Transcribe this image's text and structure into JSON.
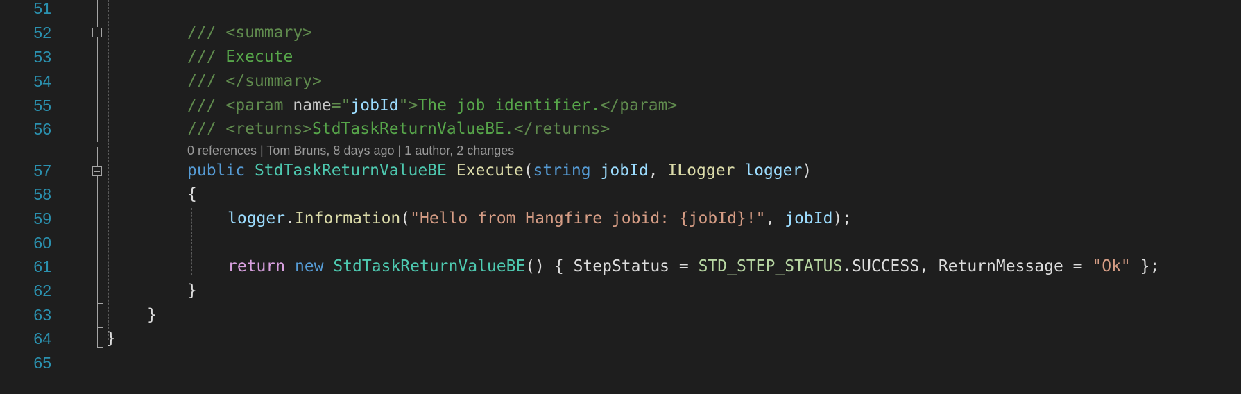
{
  "editor": {
    "lines": [
      {
        "num": "51",
        "tokens": []
      },
      {
        "num": "52",
        "tokens": [
          {
            "text": "/// ",
            "cls": "t-comtag"
          },
          {
            "text": "<summary>",
            "cls": "t-comtag"
          }
        ]
      },
      {
        "num": "53",
        "tokens": [
          {
            "text": "/// ",
            "cls": "t-comtag"
          },
          {
            "text": "Execute",
            "cls": "t-com"
          }
        ]
      },
      {
        "num": "54",
        "tokens": [
          {
            "text": "/// ",
            "cls": "t-comtag"
          },
          {
            "text": "</summary>",
            "cls": "t-comtag"
          }
        ]
      },
      {
        "num": "55",
        "tokens": [
          {
            "text": "/// ",
            "cls": "t-comtag"
          },
          {
            "text": "<param ",
            "cls": "t-comtag"
          },
          {
            "text": "name",
            "cls": "t-attr"
          },
          {
            "text": "=\"",
            "cls": "t-comtag"
          },
          {
            "text": "jobId",
            "cls": "t-param"
          },
          {
            "text": "\"",
            "cls": "t-comtag"
          },
          {
            "text": ">",
            "cls": "t-comtag"
          },
          {
            "text": "The job identifier.",
            "cls": "t-com"
          },
          {
            "text": "</param>",
            "cls": "t-comtag"
          }
        ]
      },
      {
        "num": "56",
        "tokens": [
          {
            "text": "/// ",
            "cls": "t-comtag"
          },
          {
            "text": "<returns>",
            "cls": "t-comtag"
          },
          {
            "text": "StdTaskReturnValueBE.",
            "cls": "t-com"
          },
          {
            "text": "</returns>",
            "cls": "t-comtag"
          }
        ]
      },
      {
        "num": "57",
        "tokens": [
          {
            "text": "public ",
            "cls": "t-kw"
          },
          {
            "text": "StdTaskReturnValueBE",
            "cls": "t-type"
          },
          {
            "text": " ",
            "cls": "t-plain"
          },
          {
            "text": "Execute",
            "cls": "t-method"
          },
          {
            "text": "(",
            "cls": "t-plain"
          },
          {
            "text": "string",
            "cls": "t-kw"
          },
          {
            "text": " ",
            "cls": "t-plain"
          },
          {
            "text": "jobId",
            "cls": "t-param"
          },
          {
            "text": ", ",
            "cls": "t-plain"
          },
          {
            "text": "ILogger",
            "cls": "t-method"
          },
          {
            "text": " ",
            "cls": "t-plain"
          },
          {
            "text": "logger",
            "cls": "t-param"
          },
          {
            "text": ")",
            "cls": "t-plain"
          }
        ]
      },
      {
        "num": "58",
        "tokens": [
          {
            "text": "{",
            "cls": "t-plain"
          }
        ]
      },
      {
        "num": "59",
        "tokens": [
          {
            "text": "logger",
            "cls": "t-param"
          },
          {
            "text": ".",
            "cls": "t-plain"
          },
          {
            "text": "Information",
            "cls": "t-method"
          },
          {
            "text": "(",
            "cls": "t-plain"
          },
          {
            "text": "\"Hello from Hangfire jobid: {jobId}!\"",
            "cls": "t-str"
          },
          {
            "text": ", ",
            "cls": "t-plain"
          },
          {
            "text": "jobId",
            "cls": "t-param"
          },
          {
            "text": ");",
            "cls": "t-plain"
          }
        ]
      },
      {
        "num": "60",
        "tokens": []
      },
      {
        "num": "61",
        "tokens": [
          {
            "text": "return",
            "cls": "t-ctrl"
          },
          {
            "text": " ",
            "cls": "t-plain"
          },
          {
            "text": "new",
            "cls": "t-kw"
          },
          {
            "text": " ",
            "cls": "t-plain"
          },
          {
            "text": "StdTaskReturnValueBE",
            "cls": "t-type"
          },
          {
            "text": "() { ",
            "cls": "t-plain"
          },
          {
            "text": "StepStatus",
            "cls": "t-plain"
          },
          {
            "text": " = ",
            "cls": "t-plain"
          },
          {
            "text": "STD_STEP_STATUS",
            "cls": "t-enum"
          },
          {
            "text": ".",
            "cls": "t-plain"
          },
          {
            "text": "SUCCESS",
            "cls": "t-plain"
          },
          {
            "text": ", ",
            "cls": "t-plain"
          },
          {
            "text": "ReturnMessage",
            "cls": "t-plain"
          },
          {
            "text": " = ",
            "cls": "t-plain"
          },
          {
            "text": "\"Ok\"",
            "cls": "t-str"
          },
          {
            "text": " };",
            "cls": "t-plain"
          }
        ]
      },
      {
        "num": "62",
        "tokens": [
          {
            "text": "}",
            "cls": "t-plain"
          }
        ]
      },
      {
        "num": "63",
        "tokens": [
          {
            "text": "}",
            "cls": "t-plain"
          }
        ]
      },
      {
        "num": "64",
        "tokens": [
          {
            "text": "}",
            "cls": "t-plain"
          }
        ]
      },
      {
        "num": "65",
        "tokens": []
      }
    ],
    "codelens": "0 references | Tom Bruns, 8 days ago | 1 author, 2 changes",
    "colors": {
      "background": "#1e1e1e",
      "line_number": "#2b91af",
      "comment": "#57a64a",
      "keyword": "#569cd6",
      "type": "#4ec9b0",
      "method": "#dcdcaa",
      "parameter": "#9cdcfe",
      "string": "#d69d85"
    },
    "icons": {
      "fold_52": "collapse-minus-icon",
      "fold_57": "collapse-minus-icon"
    }
  }
}
